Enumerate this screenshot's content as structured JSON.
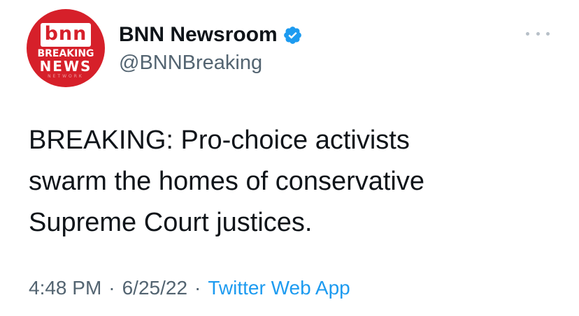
{
  "author": {
    "avatar": {
      "logo_text": "bnn",
      "line1": "BREAKING",
      "line2": "NEWS",
      "line3": "NETWORK",
      "bg_color": "#d6202a"
    },
    "display_name": "BNN Newsroom",
    "verified_icon": "verified-badge-icon",
    "handle": "@BNNBreaking"
  },
  "menu": {
    "icon": "more-options-icon"
  },
  "tweet": {
    "text": "BREAKING: Pro-choice activists\nswarm the homes of conservative\nSupreme Court justices."
  },
  "meta": {
    "time": "4:48 PM",
    "separator": "·",
    "date": "6/25/22",
    "source": "Twitter Web App",
    "link_color": "#1d9bf0"
  }
}
